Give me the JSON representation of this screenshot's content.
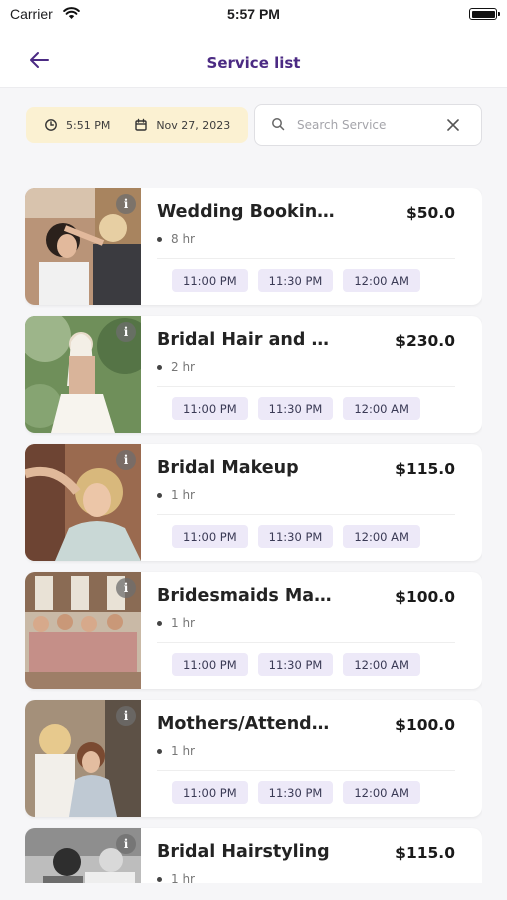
{
  "status_bar": {
    "carrier": "Carrier",
    "time": "5:57 PM"
  },
  "header": {
    "title": "Service list"
  },
  "filters": {
    "time": "5:51 PM",
    "date": "Nov 27, 2023"
  },
  "search": {
    "placeholder": "Search Service"
  },
  "colors": {
    "title": "#4b2a83",
    "chip_bg": "#fbf1d2",
    "slot_bg": "#ede9f8"
  },
  "services": [
    {
      "name": "Wedding Bookin…",
      "price": "$50.0",
      "duration": "8 hr",
      "slots": [
        "11:00 PM",
        "11:30 PM",
        "12:00 AM"
      ]
    },
    {
      "name": "Bridal Hair and …",
      "price": "$230.0",
      "duration": "2 hr",
      "slots": [
        "11:00 PM",
        "11:30 PM",
        "12:00 AM"
      ]
    },
    {
      "name": "Bridal Makeup",
      "price": "$115.0",
      "duration": "1 hr",
      "slots": [
        "11:00 PM",
        "11:30 PM",
        "12:00 AM"
      ]
    },
    {
      "name": "Bridesmaids Ma…",
      "price": "$100.0",
      "duration": "1 hr",
      "slots": [
        "11:00 PM",
        "11:30 PM",
        "12:00 AM"
      ]
    },
    {
      "name": "Mothers/Attend…",
      "price": "$100.0",
      "duration": "1 hr",
      "slots": [
        "11:00 PM",
        "11:30 PM",
        "12:00 AM"
      ]
    },
    {
      "name": "Bridal Hairstyling",
      "price": "$115.0",
      "duration": "1 hr",
      "slots": []
    }
  ]
}
